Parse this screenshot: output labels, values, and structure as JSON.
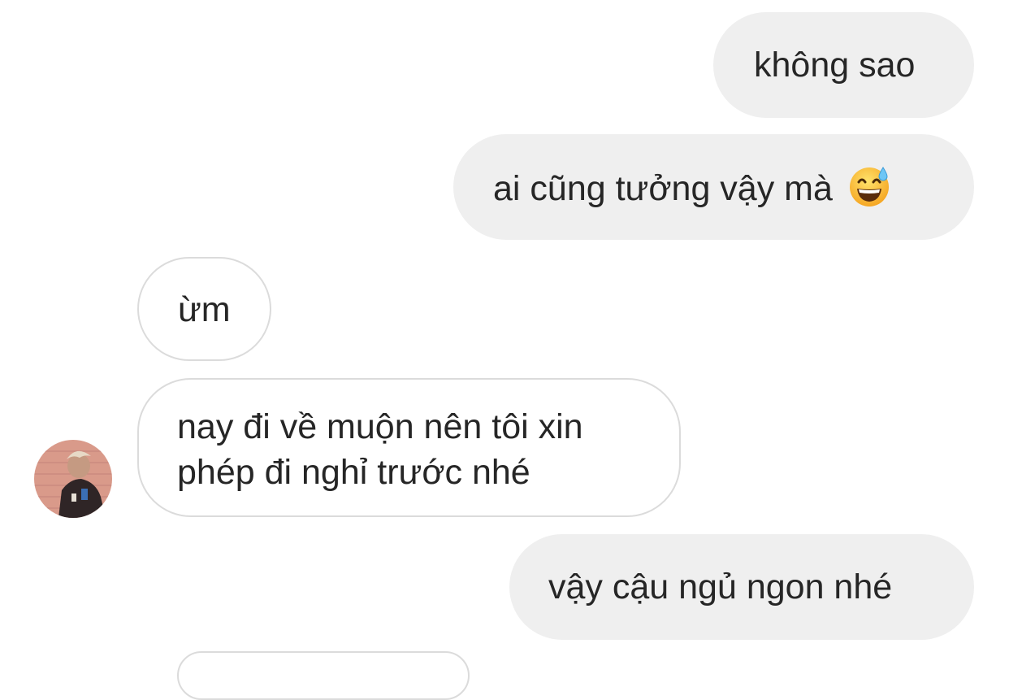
{
  "messages": [
    {
      "side": "sent",
      "text": "không sao"
    },
    {
      "side": "sent",
      "text": "ai cũng tưởng vậy mà",
      "emoji": "grinning-face-with-sweat-icon"
    },
    {
      "side": "received",
      "text": "ừm"
    },
    {
      "side": "received",
      "line1": "nay đi về muộn nên tôi xin",
      "line2": "phép đi nghỉ trước nhé",
      "avatar": "profile-photo"
    },
    {
      "side": "sent",
      "text": "vậy cậu ngủ ngon nhé"
    }
  ],
  "colors": {
    "sent_bubble": "#efefef",
    "received_border": "#dbdbdb",
    "text": "#262626"
  }
}
